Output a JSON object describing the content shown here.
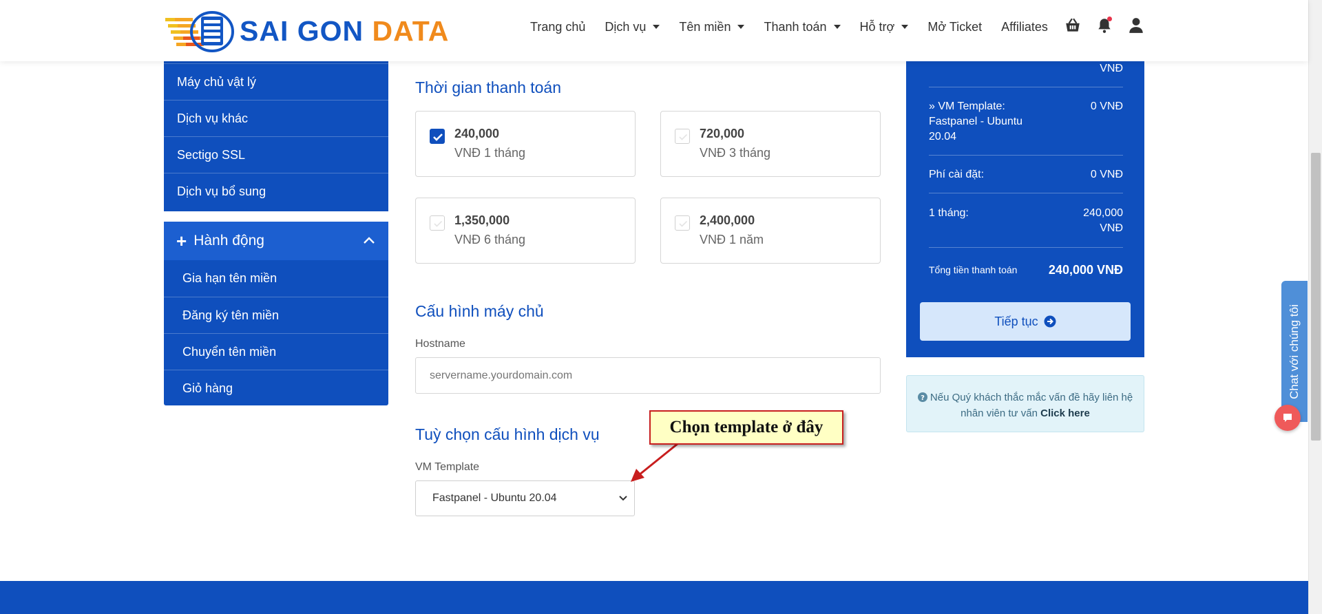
{
  "logo": {
    "word1": "SAI GON",
    "word2": "DATA"
  },
  "nav": {
    "items": [
      {
        "label": "Trang chủ",
        "dropdown": false
      },
      {
        "label": "Dịch vụ",
        "dropdown": true
      },
      {
        "label": "Tên miền",
        "dropdown": true
      },
      {
        "label": "Thanh toán",
        "dropdown": true
      },
      {
        "label": "Hỗ trợ",
        "dropdown": true
      },
      {
        "label": "Mở Ticket",
        "dropdown": false
      },
      {
        "label": "Affiliates",
        "dropdown": false
      }
    ],
    "icons": [
      "basket-icon",
      "bell-icon",
      "user-icon"
    ]
  },
  "sidebar": {
    "categories": [
      "Máy chủ vật lý",
      "Dịch vụ khác",
      "Sectigo SSL",
      "Dịch vụ bổ sung"
    ],
    "actions_title": "Hành động",
    "actions": [
      "Gia hạn tên miền",
      "Đăng ký tên miền",
      "Chuyển tên miền",
      "Giỏ hàng"
    ]
  },
  "billing": {
    "title": "Thời gian thanh toán",
    "cycles": [
      {
        "amount": "240,000",
        "period": "VNĐ 1 tháng",
        "checked": true
      },
      {
        "amount": "720,000",
        "period": "VNĐ 3 tháng",
        "checked": false
      },
      {
        "amount": "1,350,000",
        "period": "VNĐ 6 tháng",
        "checked": false
      },
      {
        "amount": "2,400,000",
        "period": "VNĐ 1 năm",
        "checked": false
      }
    ]
  },
  "server_config": {
    "title": "Cấu hình máy chủ",
    "hostname_label": "Hostname",
    "hostname_placeholder": "servername.yourdomain.com"
  },
  "options": {
    "title": "Tuỳ chọn cấu hình dịch vụ",
    "vm_label": "VM Template",
    "vm_selected": "Fastpanel - Ubuntu 20.04"
  },
  "annotation": {
    "text": "Chọn template ở đây"
  },
  "summary": {
    "top_value": "VNĐ",
    "vm_key": "» VM Template: Fastpanel - Ubuntu 20.04",
    "vm_value": "0 VNĐ",
    "setup_key": "Phí cài đặt:",
    "setup_value": "0 VNĐ",
    "month_key": "1 tháng:",
    "month_value": "240,000 VNĐ",
    "total_key": "Tổng tiền thanh toán",
    "total_value": "240,000 VNĐ",
    "continue_label": "Tiếp tục"
  },
  "help": {
    "text": "Nếu Quý khách thắc mắc vấn đề hãy liên hệ nhân viên tư vấn",
    "link": "Click here"
  },
  "chat": {
    "label": "Chat với chúng tôi"
  }
}
